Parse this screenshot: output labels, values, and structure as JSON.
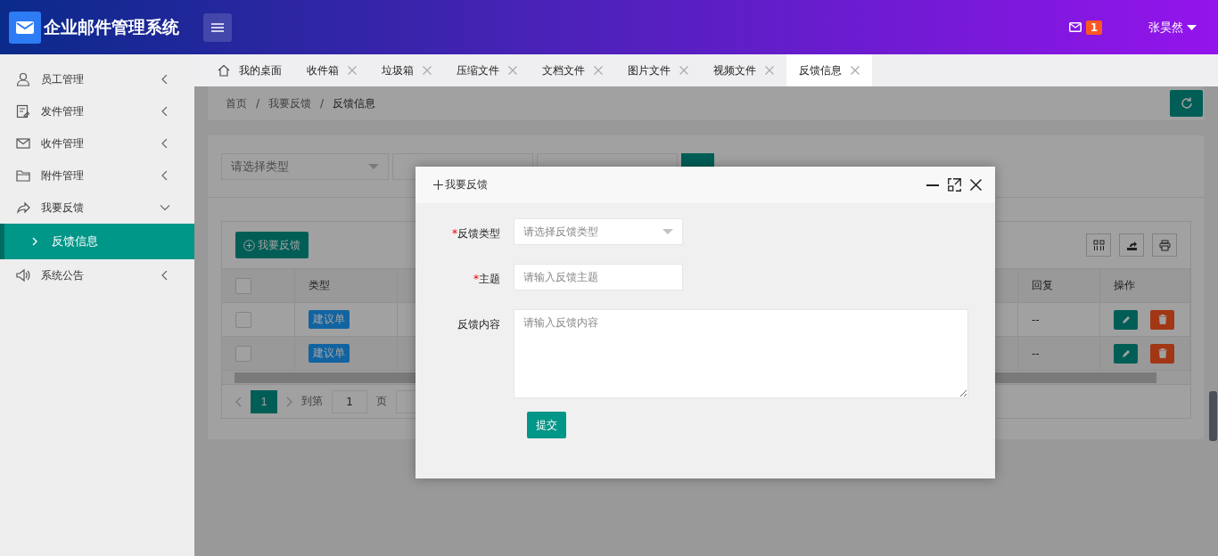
{
  "app": {
    "title": "企业邮件管理系统"
  },
  "header": {
    "mail_count": "1",
    "user": "张昊然"
  },
  "sidebar": {
    "items": [
      {
        "label": "员工管理",
        "expanded": false
      },
      {
        "label": "发件管理",
        "expanded": false
      },
      {
        "label": "收件管理",
        "expanded": false
      },
      {
        "label": "附件管理",
        "expanded": false
      },
      {
        "label": "我要反馈",
        "expanded": true,
        "children": [
          {
            "label": "反馈信息",
            "selected": true
          }
        ]
      },
      {
        "label": "系统公告",
        "expanded": false
      }
    ]
  },
  "tabs": [
    {
      "label": "我的桌面",
      "kind": "home",
      "selected": false
    },
    {
      "label": "收件箱",
      "kind": "closable",
      "selected": false
    },
    {
      "label": "垃圾箱",
      "kind": "closable",
      "selected": false
    },
    {
      "label": "压缩文件",
      "kind": "closable",
      "selected": false
    },
    {
      "label": "文档文件",
      "kind": "closable",
      "selected": false
    },
    {
      "label": "图片文件",
      "kind": "closable",
      "selected": false
    },
    {
      "label": "视频文件",
      "kind": "closable",
      "selected": false
    },
    {
      "label": "反馈信息",
      "kind": "closable",
      "selected": true
    }
  ],
  "breadcrumb": {
    "separator": "/",
    "items": [
      "首页",
      "我要反馈",
      "反馈信息"
    ]
  },
  "filters": {
    "type_select": {
      "placeholder": "请选择类型"
    }
  },
  "table": {
    "add_button": "我要反馈",
    "all_checked": false,
    "columns": [
      "类型",
      "回复",
      "操作"
    ],
    "rows": [
      {
        "checked": false,
        "type": "建议单",
        "reply": "--"
      },
      {
        "checked": false,
        "type": "建议单",
        "reply": "--"
      }
    ],
    "pager": {
      "current": "1",
      "goto_label": "到第",
      "goto_value": "1",
      "page_label": "页"
    }
  },
  "modal": {
    "title": "我要反馈",
    "required_mark": "*",
    "fields": [
      {
        "kind": "select",
        "label": "反馈类型",
        "required": true,
        "placeholder": "请选择反馈类型"
      },
      {
        "kind": "input",
        "label": "主题",
        "required": true,
        "placeholder": "请输入反馈主题"
      },
      {
        "kind": "textarea",
        "label": "反馈内容",
        "required": false,
        "placeholder": "请输入反馈内容"
      }
    ],
    "submit": "提交"
  }
}
